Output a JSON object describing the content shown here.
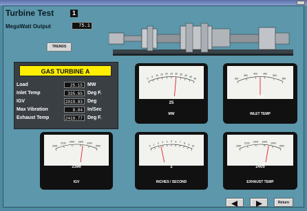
{
  "header": {
    "title": "Turbine Test",
    "unit_number": "1"
  },
  "megawatt": {
    "label": "MegaWatt Output",
    "value": "75.1"
  },
  "trends_button": "TRENDS",
  "panel": {
    "title": "GAS TURBINE A",
    "rows": [
      {
        "label": "Load",
        "value": "25.15",
        "unit": "MW"
      },
      {
        "label": "Inlet Temp",
        "value": "335.65",
        "unit": "Deg F."
      },
      {
        "label": "IGV",
        "value": "2019.83",
        "unit": "Deg"
      },
      {
        "label": "Max Vibration",
        "value": "8.04",
        "unit": "In/Sec"
      },
      {
        "label": "Exhaust Temp",
        "value": "2419.77",
        "unit": "Deg F."
      }
    ]
  },
  "meters": [
    {
      "id": "mw",
      "value": "25",
      "name": "MW",
      "ticks": [
        "0",
        "5",
        "10",
        "15",
        "20",
        "25",
        "30",
        "35",
        "40",
        "45",
        "50"
      ],
      "needle_fraction": 0.6
    },
    {
      "id": "inlet",
      "value": "340",
      "name": "INLET TEMP",
      "ticks": [
        "300",
        "350",
        "400",
        "450",
        "500",
        "550"
      ],
      "needle_fraction": 0.5
    },
    {
      "id": "igv",
      "value": "2386",
      "name": "IGV",
      "ticks": [
        "2000",
        "2100",
        "2200",
        "2300",
        "2400",
        "2500"
      ],
      "needle_fraction": 0.65
    },
    {
      "id": "vib",
      "value": "2",
      "name": "INCHES / SECOND",
      "ticks": [
        "0",
        "1",
        "2",
        "3",
        "4",
        "5",
        "6",
        "7",
        "8",
        "9",
        "10"
      ],
      "needle_fraction": 0.25
    },
    {
      "id": "exhaust",
      "value": "2405",
      "name": "EXHAUST TEMP",
      "ticks": [
        "2000",
        "2100",
        "2200",
        "2300",
        "2400",
        "2500"
      ],
      "needle_fraction": 0.7
    }
  ],
  "navigation": {
    "return_label": "Return"
  },
  "colors": {
    "background": "#5c97ab",
    "panel_title": "#ffee00",
    "needle": "#e02020"
  }
}
